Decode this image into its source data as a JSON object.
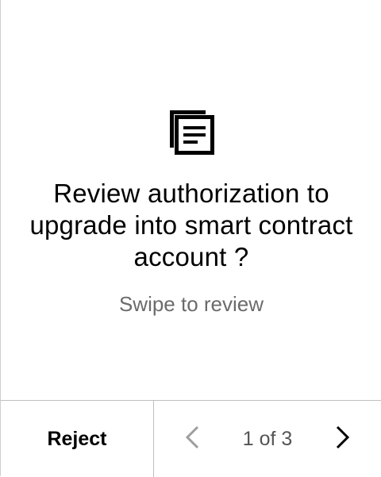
{
  "review": {
    "icon": "document-stack-icon",
    "title": "Review authorization to upgrade into smart contract account ?",
    "hint": "Swipe to review"
  },
  "footer": {
    "reject_label": "Reject",
    "page_indicator": "1 of 3",
    "prev_icon": "chevron-left-icon",
    "next_icon": "chevron-right-icon"
  },
  "colors": {
    "text": "#000000",
    "muted_text": "#6b6b6b",
    "disabled_icon": "#9e9e9e",
    "divider": "#bfbfbf",
    "background": "#ffffff"
  }
}
